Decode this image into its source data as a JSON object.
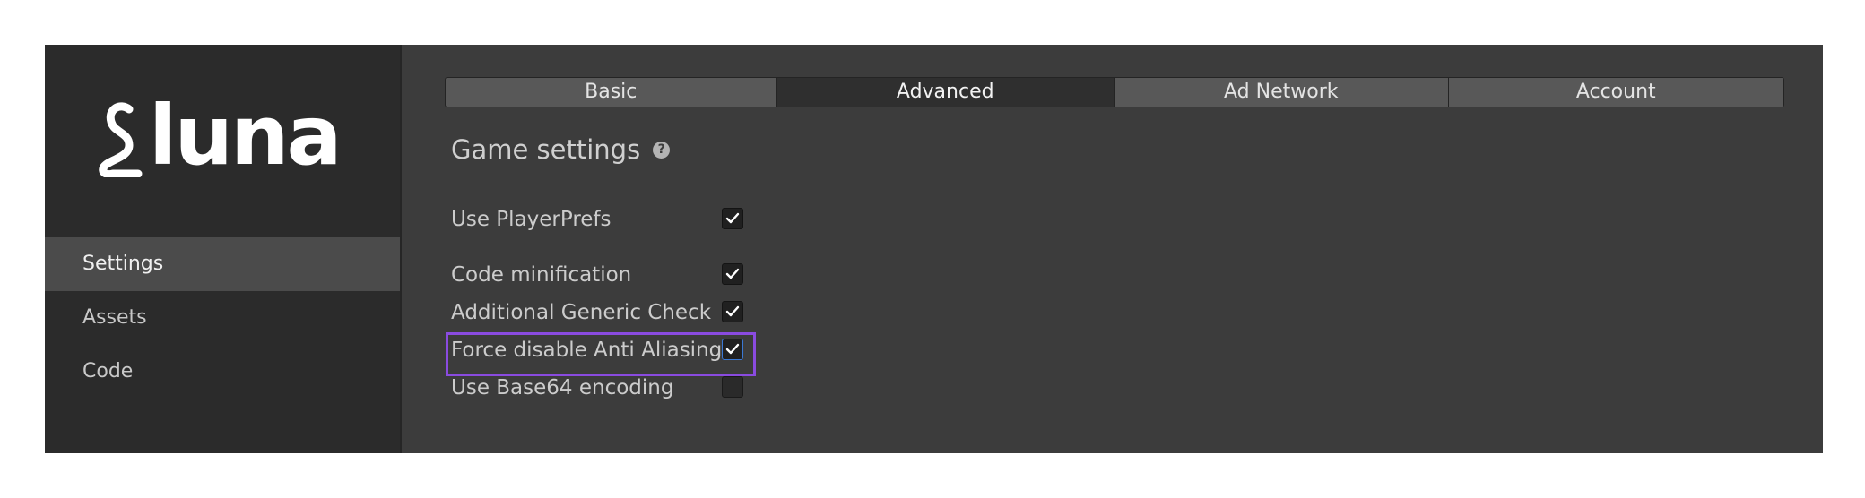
{
  "app": {
    "logo_text": "luna"
  },
  "sidebar": {
    "items": [
      {
        "label": "Settings",
        "active": true
      },
      {
        "label": "Assets",
        "active": false
      },
      {
        "label": "Code",
        "active": false
      }
    ]
  },
  "tabs": [
    {
      "label": "Basic",
      "active": false
    },
    {
      "label": "Advanced",
      "active": true
    },
    {
      "label": "Ad Network",
      "active": false
    },
    {
      "label": "Account",
      "active": false
    }
  ],
  "section": {
    "title": "Game settings",
    "help_icon": "question-mark",
    "help_glyph": "?"
  },
  "settings": [
    {
      "label": "Use PlayerPrefs",
      "checked": true
    },
    {
      "label": "Code minification",
      "checked": true
    },
    {
      "label": "Additional Generic Check",
      "checked": true
    },
    {
      "label": "Force disable Anti Aliasing",
      "checked": true,
      "highlighted": true
    },
    {
      "label": "Use Base64 encoding",
      "checked": false
    }
  ],
  "colors": {
    "highlight": "#8a4be0",
    "focus": "#3a78d4",
    "window_bg": "#3c3c3c",
    "sidebar_bg": "#2b2b2b"
  }
}
